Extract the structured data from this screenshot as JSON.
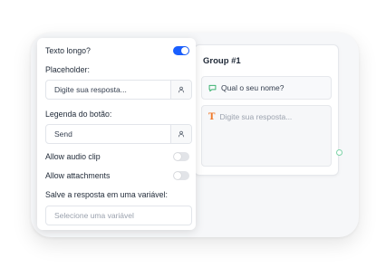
{
  "group": {
    "title": "Group #1",
    "bubble_text": "Qual o seu nome?",
    "input_placeholder": "Digite sua resposta...",
    "bubble_icon": "chat-bubble-icon",
    "input_icon": "text-input-icon",
    "accent_bubble": "#3cb371",
    "accent_input": "#f07a2c"
  },
  "panel": {
    "long_text_label": "Texto longo?",
    "long_text_on": true,
    "placeholder_label": "Placeholder:",
    "placeholder_value": "Digite sua resposta...",
    "button_label_label": "Legenda do botão:",
    "button_label_value": "Send",
    "audio_label": "Allow audio clip",
    "audio_on": false,
    "attachments_label": "Allow attachments",
    "attachments_on": false,
    "save_label": "Salve a resposta em uma variável:",
    "variable_placeholder": "Selecione uma variável",
    "variable_icon": "user-variable-icon",
    "toggle_color": "#1a5fff"
  }
}
